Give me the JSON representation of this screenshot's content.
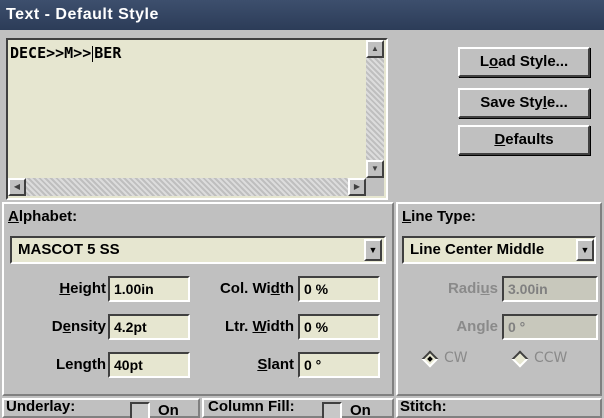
{
  "window": {
    "title": "Text - Default Style"
  },
  "editor": {
    "text_before_caret": "DECE>>M>>",
    "text_after_caret": "BER"
  },
  "buttons": {
    "load_style": {
      "pre": "L",
      "ul": "o",
      "post": "ad Style..."
    },
    "save_style": {
      "pre": "Save Sty",
      "ul": "l",
      "post": "e..."
    },
    "defaults": {
      "pre": "",
      "ul": "D",
      "post": "efaults"
    }
  },
  "alphabet": {
    "label_ul": "A",
    "label_rest": "lphabet:",
    "font": "MASCOT 5 SS",
    "height": {
      "label_ul": "H",
      "label_rest": "eight",
      "value": "1.00in"
    },
    "density": {
      "label_pre": "D",
      "label_ul": "e",
      "label_rest": "nsity",
      "value": "4.2pt"
    },
    "length": {
      "label": "Length",
      "value": "40pt"
    },
    "col_width": {
      "label_pre": "Col. Wi",
      "label_ul": "d",
      "label_rest": "th",
      "value": "0 %"
    },
    "ltr_width": {
      "label_pre": "Ltr. ",
      "label_ul": "W",
      "label_rest": "idth",
      "value": "0 %"
    },
    "slant": {
      "label_ul": "S",
      "label_rest": "lant",
      "value": "0 °"
    }
  },
  "line_type": {
    "label_ul": "L",
    "label_rest": "ine Type:",
    "value": "Line Center Middle",
    "radius": {
      "label_pre": "Radi",
      "label_ul": "u",
      "label_rest": "s",
      "value": "3.00in"
    },
    "angle": {
      "label_pre": "An",
      "label_ul": "g",
      "label_rest": "le",
      "value": "0 °"
    },
    "cw": "CW",
    "ccw": "CCW"
  },
  "bottom": {
    "underlay": "Underlay:",
    "underlay_on": "On",
    "column_fill": "Column Fill:",
    "column_fill_on": "On",
    "stitch": "Stitch:"
  },
  "colors": {
    "title_bg": "#2c3c58",
    "field_bg": "#e6e6d0",
    "face": "#c0c0c0"
  }
}
